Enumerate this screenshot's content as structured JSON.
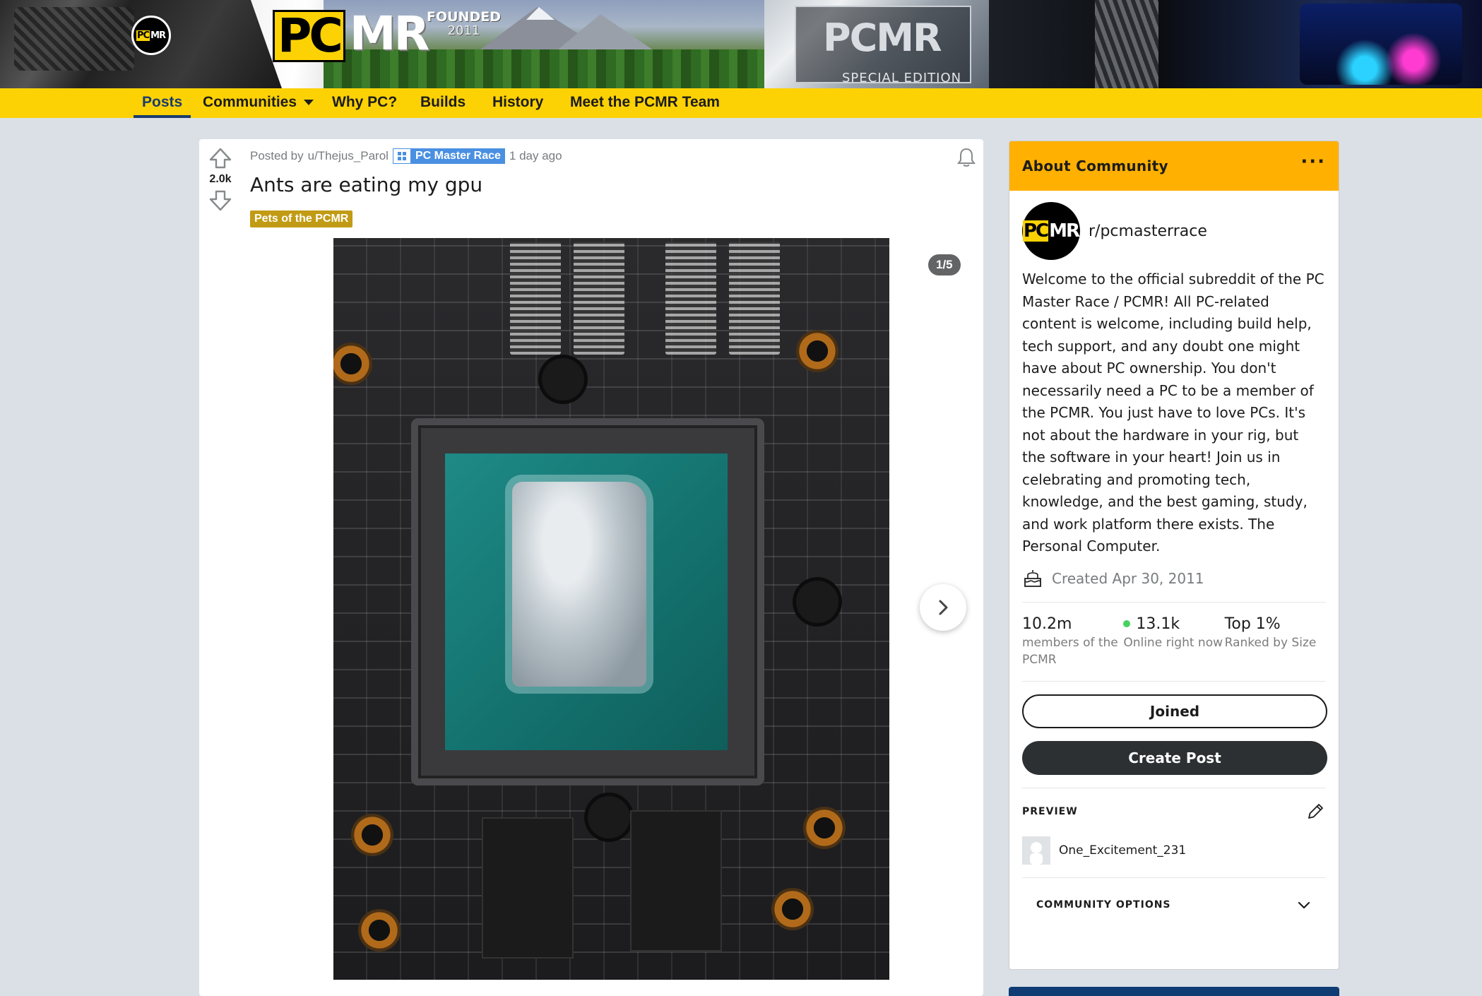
{
  "banner": {
    "logo_pc": "PC",
    "logo_mr": "MR",
    "founded_label": "FOUNDED",
    "founded_year": "2011",
    "special_edition_logo": "PCMR",
    "special_edition_text": "SPECIAL EDITION"
  },
  "nav": {
    "items": [
      {
        "label": "Posts",
        "active": true
      },
      {
        "label": "Communities",
        "dropdown": true
      },
      {
        "label": "Why PC?"
      },
      {
        "label": "Builds"
      },
      {
        "label": "History"
      },
      {
        "label": "Meet the PCMR Team"
      }
    ]
  },
  "post": {
    "vote_count": "2.0k",
    "posted_by_prefix": "Posted by",
    "author": "u/Thejus_Parol",
    "user_flair": "PC Master Race",
    "time_ago": "1 day ago",
    "title": "Ants are eating my gpu",
    "post_flair": "Pets of the PCMR",
    "gallery_counter": "1/5",
    "icons": {
      "upvote": "upvote-arrow-icon",
      "downvote": "downvote-arrow-icon",
      "notify": "bell-icon",
      "next": "chevron-right-icon"
    },
    "colors": {
      "user_flair_bg": "#4a90e2",
      "post_flair_bg": "#c29b14"
    }
  },
  "sidebar": {
    "header_title": "About Community",
    "community_name": "r/pcmasterrace",
    "description": "Welcome to the official subreddit of the PC Master Race / PCMR! All PC-related content is welcome, including build help, tech support, and any doubt one might have about PC ownership. You don't necessarily need a PC to be a member of the PCMR. You just have to love PCs. It's not about the hardware in your rig, but the software in your heart! Join us in celebrating and promoting tech, knowledge, and the best gaming, study, and work platform there exists. The Personal Computer.",
    "created": "Created Apr 30, 2011",
    "stats": [
      {
        "value": "10.2m",
        "label": "members of the PCMR"
      },
      {
        "value": "13.1k",
        "label": "Online right now",
        "online_dot": true
      },
      {
        "value": "Top 1%",
        "label": "Ranked by Size"
      }
    ],
    "joined_label": "Joined",
    "create_post_label": "Create Post",
    "preview_label": "PREVIEW",
    "preview_user": "One_Excitement_231",
    "community_options_label": "COMMUNITY OPTIONS",
    "colors": {
      "header_bg": "#ffb000",
      "online_dot": "#46d160"
    }
  },
  "theme": {
    "nav_bg": "#fdd204",
    "page_bg": "#dae0e6",
    "active_nav": "#1a3d6e"
  }
}
